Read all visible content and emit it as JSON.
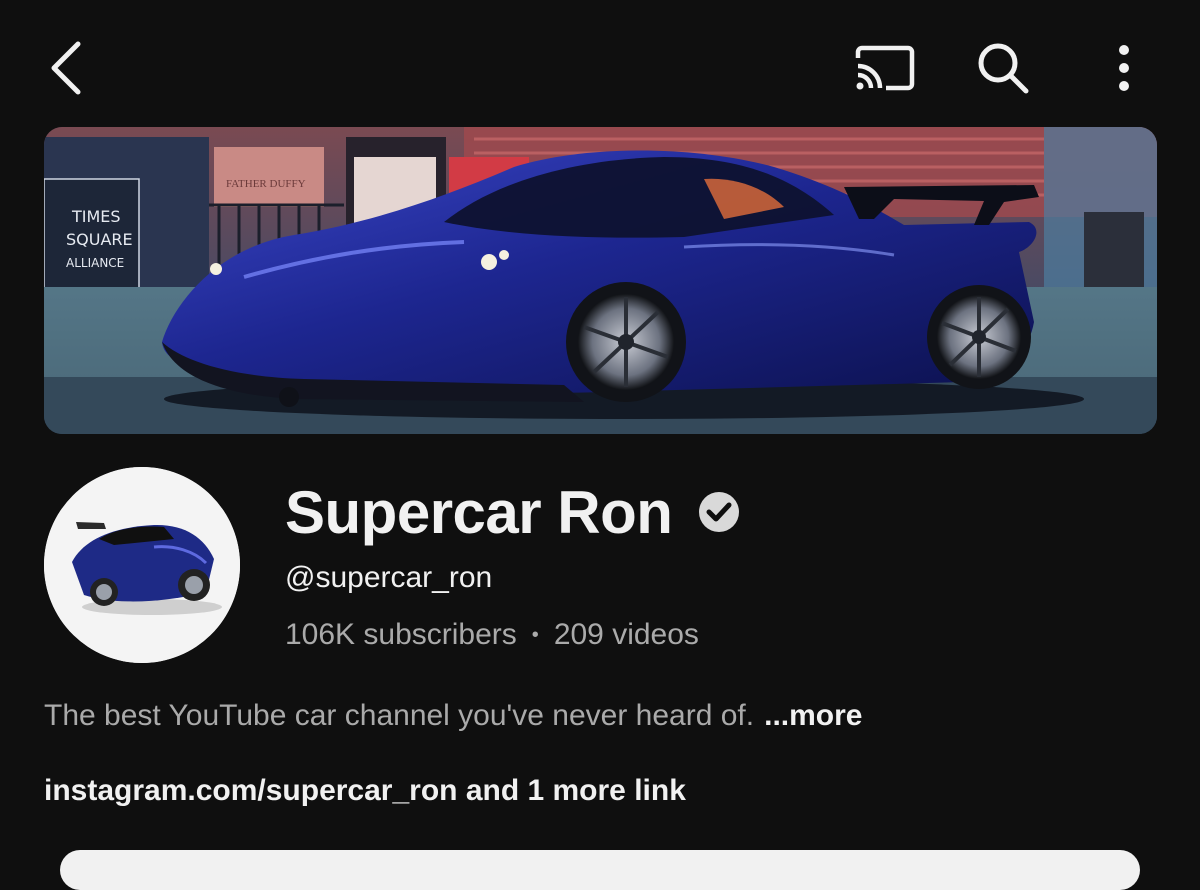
{
  "topbar": {
    "back_icon": "chevron-left-icon",
    "cast_icon": "cast-icon",
    "search_icon": "search-icon",
    "more_icon": "more-vertical-icon"
  },
  "banner": {
    "sign_line1": "TIMES",
    "sign_line2": "SQUARE",
    "sign_line3": "ALLIANCE",
    "storefront_text": "FATHER DUFFY"
  },
  "channel": {
    "name": "Supercar Ron",
    "verified_icon": "verified-check-icon",
    "handle": "@supercar_ron",
    "subscribers": "106K subscribers",
    "separator": "•",
    "videos": "209 videos",
    "description": "The best YouTube car channel you've never heard of.",
    "more_label": "...more",
    "links_text": "instagram.com/supercar_ron and 1 more link"
  },
  "colors": {
    "background": "#0f0f0f",
    "primary_text": "#f1f1f1",
    "secondary_text": "#aaaaaa",
    "car_blue": "#1f2a8c"
  }
}
